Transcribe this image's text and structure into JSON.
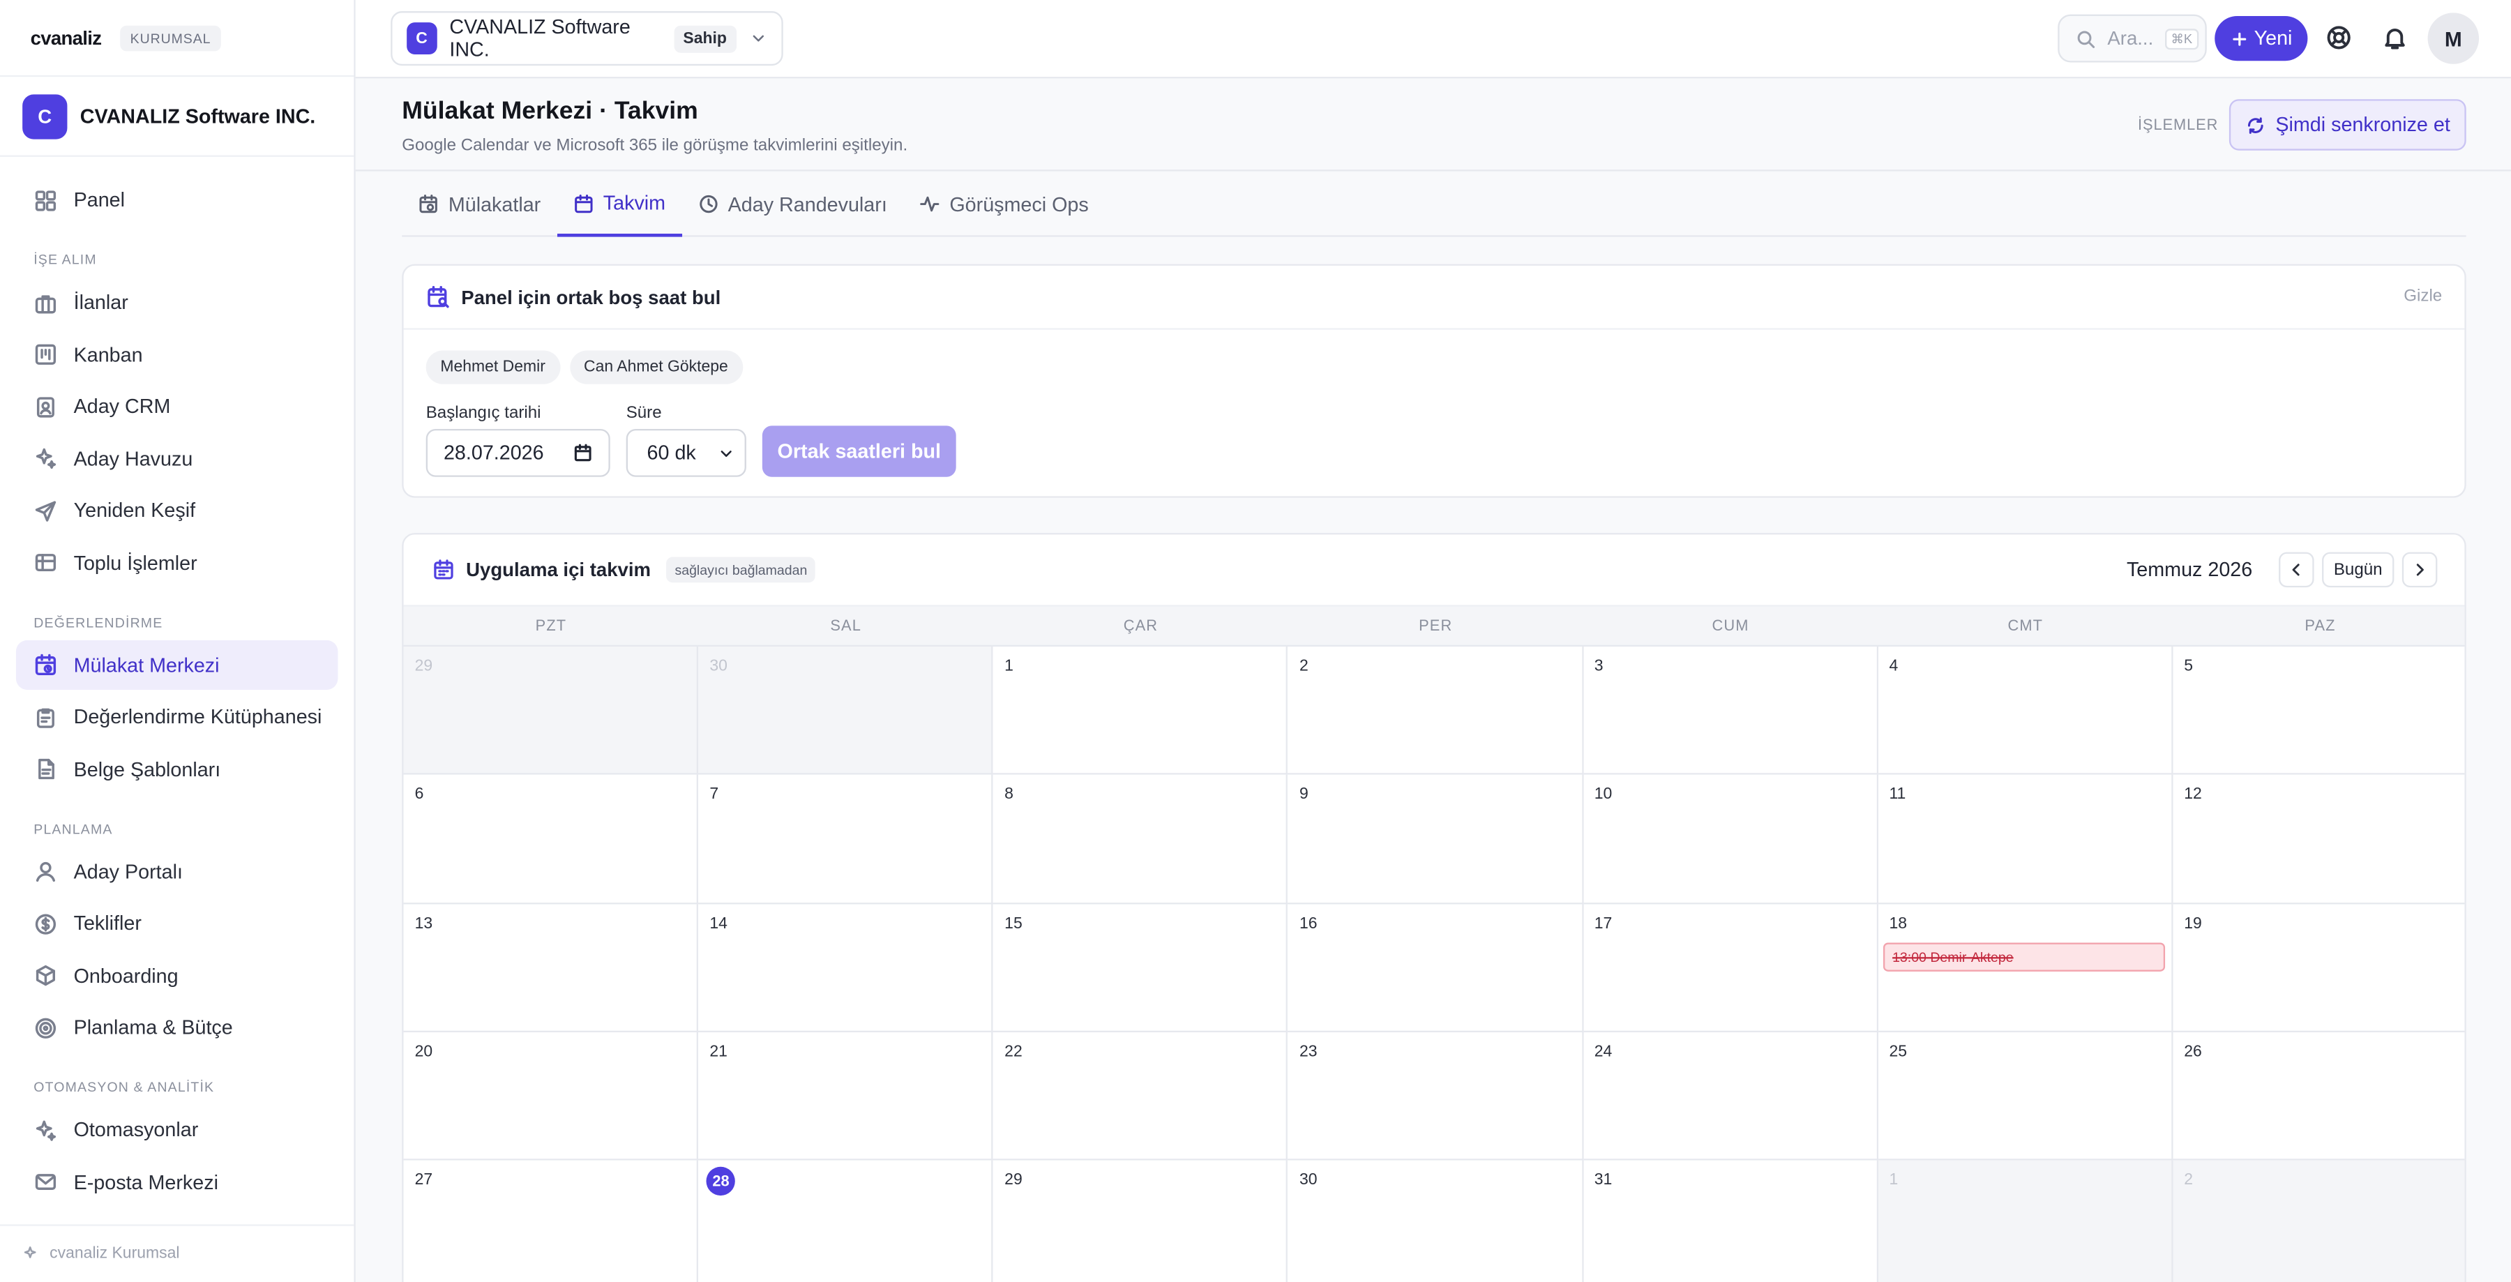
{
  "sidebar": {
    "logo": "cvanaliz",
    "tier": "KURUMSAL",
    "org_badge": "C",
    "org_name": "CVANALIZ Software INC.",
    "panel": "Panel",
    "section_hiring": "İŞE ALIM",
    "hiring": [
      "İlanlar",
      "Kanban",
      "Aday CRM",
      "Aday Havuzu",
      "Yeniden Keşif",
      "Toplu İşlemler"
    ],
    "section_eval": "DEĞERLENDİRME",
    "eval": [
      "Mülakat Merkezi",
      "Değerlendirme Kütüphanesi",
      "Belge Şablonları"
    ],
    "section_plan": "PLANLAMA",
    "plan": [
      "Aday Portalı",
      "Teklifler",
      "Onboarding",
      "Planlama & Bütçe"
    ],
    "section_auto": "OTOMASYON & ANALİTİK",
    "auto": [
      "Otomasyonlar",
      "E-posta Merkezi"
    ],
    "footer": "cvanaliz Kurumsal"
  },
  "topbar": {
    "org_badge": "C",
    "org_name": "CVANALIZ Software INC.",
    "role": "Sahip",
    "search_placeholder": "Ara...",
    "search_shortcut": "⌘K",
    "new_label": "Yeni",
    "avatar": "M"
  },
  "header": {
    "title": "Mülakat Merkezi · Takvim",
    "subtitle": "Google Calendar ve Microsoft 365 ile görüşme takvimlerini eşitleyin.",
    "actions_label": "İŞLEMLER",
    "sync_label": "Şimdi senkronize et"
  },
  "tabs": [
    "Mülakatlar",
    "Takvim",
    "Aday Randevuları",
    "Görüşmeci Ops"
  ],
  "panel_finder": {
    "title": "Panel için ortak boş saat bul",
    "hide": "Gizle",
    "people": [
      "Mehmet Demir",
      "Can Ahmet Göktepe"
    ],
    "start_label": "Başlangıç tarihi",
    "start_value": "28.07.2026",
    "duration_label": "Süre",
    "duration_value": "60 dk",
    "find_label": "Ortak saatleri bul"
  },
  "calendar": {
    "title": "Uygulama içi takvim",
    "badge": "sağlayıcı bağlamadan",
    "month": "Temmuz 2026",
    "today_label": "Bugün",
    "weekdays": [
      "PZT",
      "SAL",
      "ÇAR",
      "PER",
      "CUM",
      "CMT",
      "PAZ"
    ],
    "days": [
      {
        "n": "29",
        "muted": true
      },
      {
        "n": "30",
        "muted": true
      },
      {
        "n": "1"
      },
      {
        "n": "2"
      },
      {
        "n": "3"
      },
      {
        "n": "4"
      },
      {
        "n": "5"
      },
      {
        "n": "6"
      },
      {
        "n": "7"
      },
      {
        "n": "8"
      },
      {
        "n": "9"
      },
      {
        "n": "10"
      },
      {
        "n": "11"
      },
      {
        "n": "12"
      },
      {
        "n": "13"
      },
      {
        "n": "14"
      },
      {
        "n": "15"
      },
      {
        "n": "16"
      },
      {
        "n": "17"
      },
      {
        "n": "18",
        "event": "13:00 Demir-Aktepe"
      },
      {
        "n": "19"
      },
      {
        "n": "20"
      },
      {
        "n": "21"
      },
      {
        "n": "22"
      },
      {
        "n": "23"
      },
      {
        "n": "24"
      },
      {
        "n": "25"
      },
      {
        "n": "26"
      },
      {
        "n": "27"
      },
      {
        "n": "28",
        "today": true
      },
      {
        "n": "29"
      },
      {
        "n": "30"
      },
      {
        "n": "31"
      },
      {
        "n": "1",
        "muted": true
      },
      {
        "n": "2",
        "muted": true
      }
    ]
  }
}
